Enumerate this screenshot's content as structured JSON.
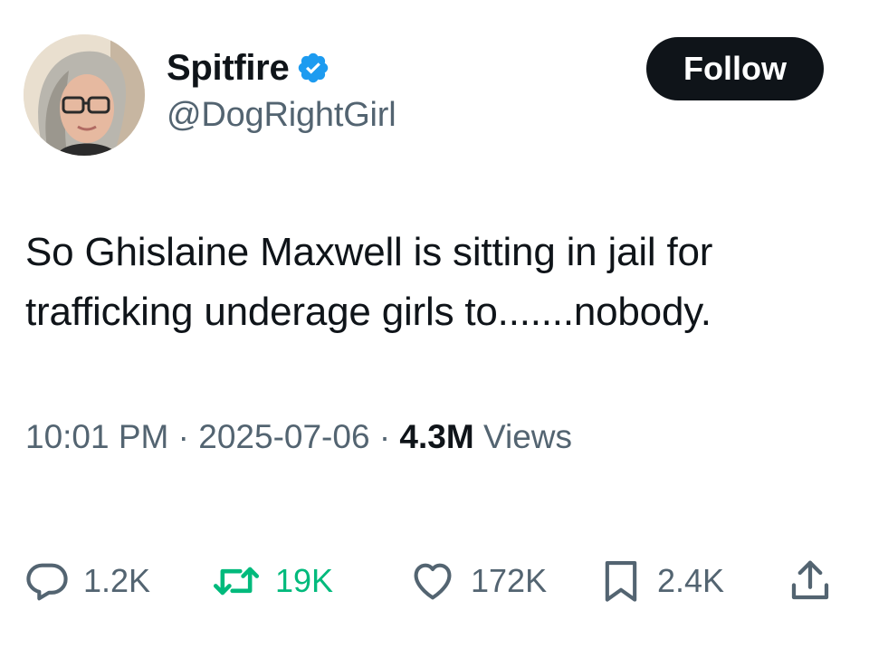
{
  "author": {
    "display_name": "Spitfire",
    "handle": "@DogRightGirl",
    "verified": true,
    "verified_color": "#1d9bf0"
  },
  "follow_button": {
    "label": "Follow"
  },
  "tweet": {
    "text_line1": "So Ghislaine Maxwell is sitting in jail for",
    "text_line2": "trafficking underage girls to.......nobody."
  },
  "meta": {
    "time": "10:01 PM",
    "separator": "·",
    "date": "2025-07-06",
    "views_count": "4.3M",
    "views_label": "Views"
  },
  "actions": {
    "replies": "1.2K",
    "retweets": "19K",
    "likes": "172K",
    "bookmarks": "2.4K"
  },
  "icons": {
    "reply": "reply-icon",
    "retweet": "retweet-icon",
    "like": "heart-icon",
    "bookmark": "bookmark-icon",
    "share": "share-icon",
    "verified": "verified-badge-icon"
  },
  "colors": {
    "text_primary": "#0f1419",
    "text_secondary": "#536471",
    "retweet_accent": "#00ba7c",
    "follow_bg": "#0f1419"
  }
}
